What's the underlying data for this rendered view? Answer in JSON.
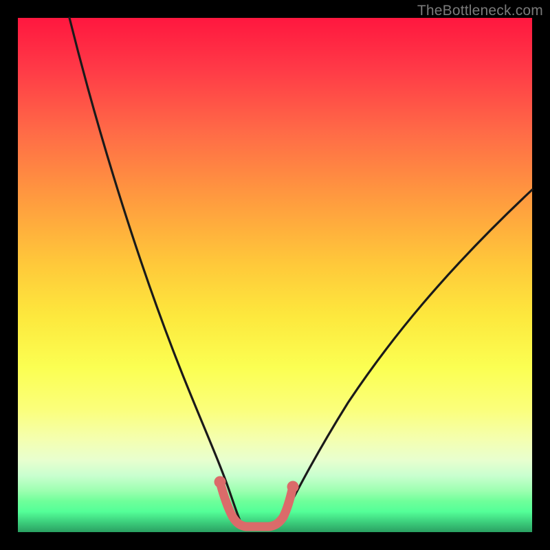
{
  "watermark": "TheBottleneck.com",
  "colors": {
    "background": "#000000",
    "line_main": "#1a1a1a",
    "line_highlight": "#db6b6a"
  },
  "chart_data": {
    "type": "line",
    "title": "",
    "xlabel": "",
    "ylabel": "",
    "xlim": [
      0,
      100
    ],
    "ylim": [
      0,
      100
    ],
    "series": [
      {
        "name": "left-curve",
        "x": [
          10,
          15,
          20,
          25,
          30,
          34,
          38,
          40,
          42
        ],
        "y": [
          100,
          80,
          60,
          42,
          28,
          17,
          8,
          4,
          2
        ]
      },
      {
        "name": "right-curve",
        "x": [
          49,
          51,
          55,
          60,
          68,
          78,
          88,
          100
        ],
        "y": [
          2,
          4,
          10,
          18,
          30,
          44,
          55,
          67
        ]
      },
      {
        "name": "highlight-bottom",
        "x": [
          38,
          39,
          40,
          41,
          42,
          43,
          44,
          45,
          46,
          47,
          48,
          49,
          50,
          51,
          52,
          53
        ],
        "y": [
          8,
          5,
          4,
          2.5,
          1.8,
          1.3,
          1.1,
          1,
          1,
          1.2,
          1.6,
          2.2,
          3.2,
          4.2,
          6.5,
          9
        ]
      }
    ],
    "gradient_stops": [
      {
        "pct": 0,
        "color": "#ff173f"
      },
      {
        "pct": 35,
        "color": "#ff9a3f"
      },
      {
        "pct": 58,
        "color": "#fde83d"
      },
      {
        "pct": 82,
        "color": "#f4ffb0"
      },
      {
        "pct": 94,
        "color": "#6fff9a"
      },
      {
        "pct": 100,
        "color": "#2aa062"
      }
    ]
  }
}
